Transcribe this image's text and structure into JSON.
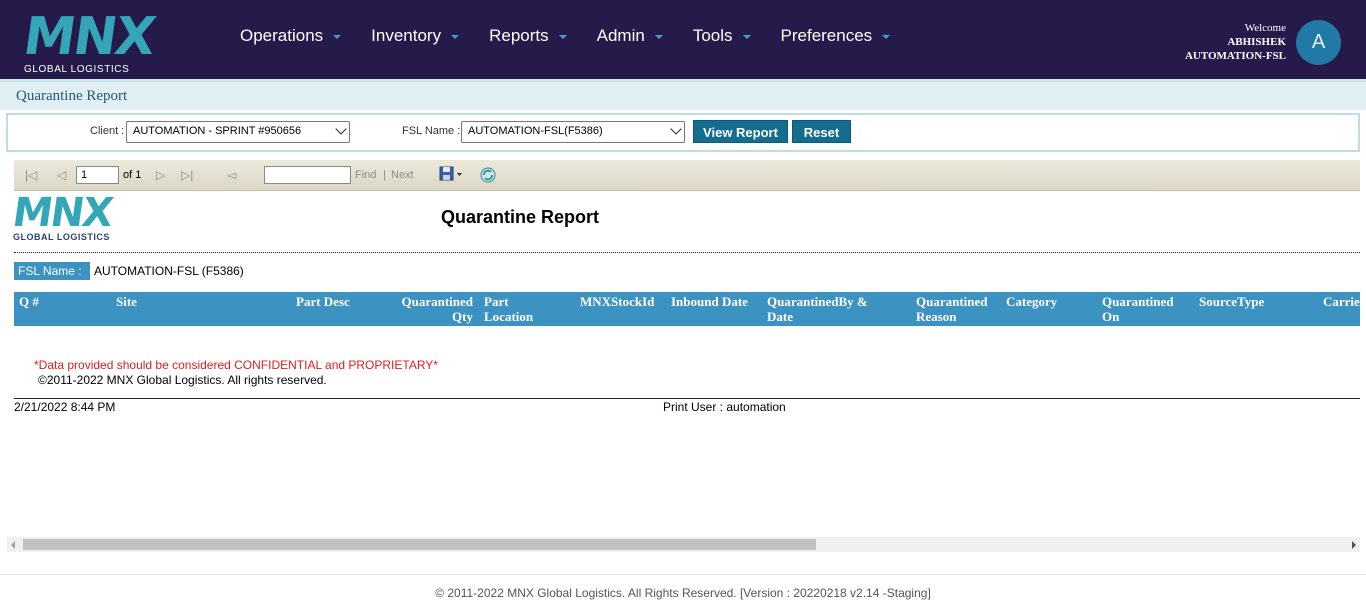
{
  "header": {
    "logo_text": "MNX",
    "logo_sub": "GLOBAL LOGISTICS",
    "nav": [
      "Operations",
      "Inventory",
      "Reports",
      "Admin",
      "Tools",
      "Preferences"
    ],
    "welcome_label": "Welcome",
    "user_first": "ABHISHEK",
    "user_last": "AUTOMATION-FSL",
    "avatar_initial": "A"
  },
  "page_title": "Quarantine Report",
  "filters": {
    "client_label": "Client :",
    "client_value": "AUTOMATION - SPRINT #950656",
    "fsl_label": "FSL Name :",
    "fsl_value": "AUTOMATION-FSL(F5386)",
    "view_report": "View Report",
    "reset": "Reset"
  },
  "toolbar": {
    "page_value": "1",
    "of_pages": "of 1",
    "find": "Find",
    "separator": "|",
    "next": "Next"
  },
  "report": {
    "title": "Quarantine Report",
    "fsl_label": "FSL Name :",
    "fsl_value": "AUTOMATION-FSL (F5386)",
    "columns": [
      "Q #",
      "Site",
      "Part Desc",
      "Quarantined Qty",
      "Part Location",
      "MNXStockId",
      "Inbound Date",
      "QuarantinedBy & Date",
      "Quarantined Reason",
      "Category",
      "Quarantined On",
      "SourceType",
      "Carrie"
    ],
    "confidential": "*Data provided should be considered CONFIDENTIAL and PROPRIETARY*",
    "copyright": "©2011-2022 MNX Global Logistics. All rights reserved.",
    "timestamp": "2/21/2022 8:44 PM",
    "print_user": "Print User : automation"
  },
  "footer": "© 2011-2022 MNX Global Logistics. All Rights Reserved. [Version : 20220218 v2.14 -Staging]",
  "colors": {
    "header_bg": "#251a4a",
    "brand_teal": "#35a6b8",
    "button_bg": "#126d8e",
    "table_header_bg": "#3c92c1",
    "confidential_red": "#e0201c"
  }
}
